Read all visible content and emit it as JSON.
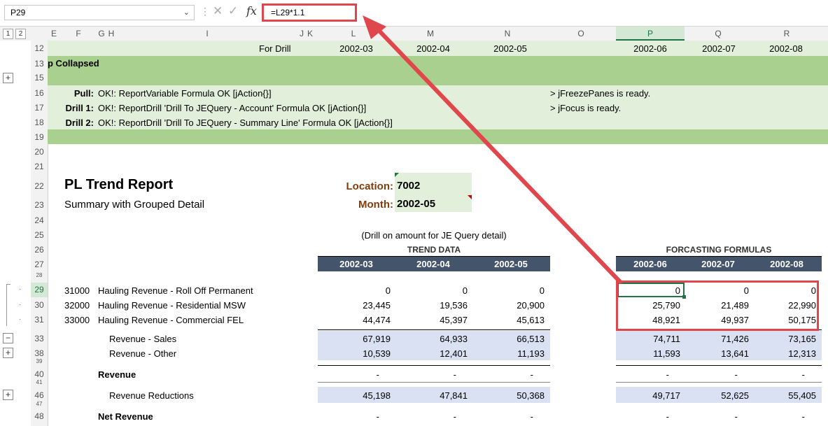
{
  "formula_bar": {
    "name_box": "P29",
    "formula": "=L29*1.1",
    "cancel_glyph": "✕",
    "enter_glyph": "✓",
    "fx_label": "fx"
  },
  "outline_levels": [
    "1",
    "2"
  ],
  "columns": [
    "E",
    "F",
    "G",
    "H",
    "I",
    "J",
    "K",
    "L",
    "M",
    "N",
    "O",
    "P",
    "Q",
    "R"
  ],
  "rows": [
    "12",
    "13",
    "15",
    "16",
    "17",
    "18",
    "19",
    "20",
    "21",
    "22",
    "23",
    "24",
    "25",
    "26",
    "27",
    "28",
    "29",
    "30",
    "31",
    "33",
    "38",
    "39",
    "40",
    "41",
    "46",
    "47",
    "48"
  ],
  "banner": {
    "for_drill": "For Drill",
    "periods_a": [
      "2002-03",
      "2002-04",
      "2002-05"
    ],
    "periods_b": [
      "2002-06",
      "2002-07",
      "2002-08"
    ],
    "collapsed": "p Collapsed",
    "pull_label": "Pull:",
    "pull_msg": "OK!: ReportVariable Formula OK [jAction{}]",
    "drill1_label": "Drill 1:",
    "drill1_msg": "OK!: ReportDrill 'Drill To JEQuery - Account' Formula OK [jAction{}]",
    "drill2_label": "Drill 2:",
    "drill2_msg": "OK!: ReportDrill 'Drill To JEQuery - Summary Line' Formula OK [jAction{}]",
    "freeze_msg": "> jFreezePanes is ready.",
    "focus_msg": "> jFocus is ready."
  },
  "report": {
    "title": "PL Trend Report",
    "subtitle": "Summary with Grouped Detail",
    "location_label": "Location:",
    "location_value": "7002",
    "month_label": "Month:",
    "month_value": "2002-05",
    "drill_note": "(Drill on amount for JE Query detail)",
    "trend_header": "TREND DATA",
    "forecast_header": "FORCASTING FORMULAS"
  },
  "table": {
    "trend_periods": [
      "2002-03",
      "2002-04",
      "2002-05"
    ],
    "forecast_periods": [
      "2002-06",
      "2002-07",
      "2002-08"
    ],
    "lines": [
      {
        "code": "31000",
        "name": "Hauling Revenue - Roll Off Permanent",
        "trend": [
          "0",
          "0",
          "0"
        ],
        "forecast": [
          "0",
          "0",
          "0"
        ]
      },
      {
        "code": "32000",
        "name": "Hauling Revenue - Residential MSW",
        "trend": [
          "23,445",
          "19,536",
          "20,900"
        ],
        "forecast": [
          "25,790",
          "21,489",
          "22,990"
        ]
      },
      {
        "code": "33000",
        "name": "Hauling Revenue - Commercial FEL",
        "trend": [
          "44,474",
          "45,397",
          "45,613"
        ],
        "forecast": [
          "48,921",
          "49,937",
          "50,175"
        ]
      }
    ],
    "groups": [
      {
        "label": "Revenue - Sales",
        "trend": [
          "67,919",
          "64,933",
          "66,513"
        ],
        "forecast": [
          "74,711",
          "71,426",
          "73,165"
        ],
        "toggle": "−"
      },
      {
        "label": "Revenue - Other",
        "trend": [
          "10,539",
          "12,401",
          "11,193"
        ],
        "forecast": [
          "11,593",
          "13,641",
          "12,313"
        ],
        "toggle": "+"
      }
    ],
    "revenue": {
      "label": "Revenue",
      "trend": [
        "-",
        "-",
        "-"
      ],
      "forecast": [
        "-",
        "-",
        "-"
      ]
    },
    "reductions": {
      "label": "Revenue Reductions",
      "trend": [
        "45,198",
        "47,841",
        "50,368"
      ],
      "forecast": [
        "49,717",
        "52,625",
        "55,405"
      ],
      "toggle": "+"
    },
    "net_revenue": {
      "label": "Net Revenue",
      "trend": [
        "-",
        "-",
        "-"
      ],
      "forecast": [
        "-",
        "-",
        "-"
      ]
    }
  },
  "outline_toggles": {
    "row13": "+"
  },
  "colors": {
    "annotation_red": "#e0474c",
    "navy": "#44546a",
    "light_green": "#e2efda",
    "mid_green": "#a9d08e",
    "pale_blue": "#d9e1f2"
  }
}
